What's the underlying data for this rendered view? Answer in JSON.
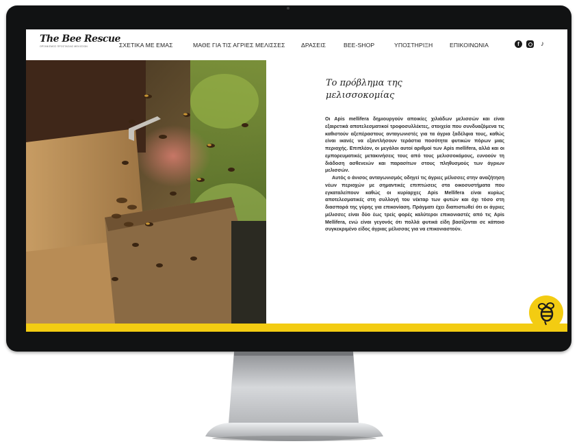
{
  "site": {
    "logo_title": "The Bee Rescue",
    "logo_subtitle": "ΟΡΓΑΝΙΣΜΟΣ ΠΡΟΣΤΑΣΙΑΣ ΜΕΛΙΣΣΩΝ"
  },
  "nav": {
    "items": [
      {
        "label": "ΣΧΕΤΙΚΑ ΜΕ ΕΜΑΣ"
      },
      {
        "label": "ΜΑΘΕ ΓΙΑ ΤΙΣ ΑΓΡΙΕΣ ΜΕΛΙΣΣΕΣ"
      },
      {
        "label": "ΔΡΑΣΕΙΣ"
      },
      {
        "label": "BEE-SHOP"
      },
      {
        "label": "ΥΠΟΣΤΗΡΙΞΗ"
      },
      {
        "label": "ΕΠΙΚΟΙΝΩΝΙΑ"
      }
    ],
    "social": [
      "facebook-icon",
      "instagram-icon",
      "tiktok-icon"
    ]
  },
  "article": {
    "heading_line1": "Το πρόβλημα της",
    "heading_line2": "μελισσοκομίας",
    "paragraph1": "Οι Apis mellifera δημιουργούν αποικίες χιλιάδων μελισσών και είναι εξαιρετικά αποτελεσματικοί τροφοσυλλέκτες, στοιχεία που συνδυαζόμενα τις καθιστούν αξεπέραστους ανταγωνιστές για τα άγρια ξαδέλφια τους, καθώς είναι ικανές να εξαντλήσουν τεράστια ποσότητα φυτικών πόρων μιας περιοχής. Επιπλέον, οι μεγάλοι αυτοί αριθμοί των Apis mellifera, αλλά και οι εμπορευματικές μετακινήσεις τους από τους μελισσοκόμους, ευνοούν τη διάδοση ασθενειών και παρασίτων στους πληθυσμούς των άγριων μελισσών.",
    "paragraph2": "Αυτός ο άνισος ανταγωνισμός οδηγεί τις άγριες μέλισσες στην αναζήτηση νέων περιοχών με σημαντικές επιπτώσεις στα οικοσυστήματα που εγκαταλείπουν καθώς οι κυρίαρχες Apis Mellifera είναι κυρίως αποτελεσματικές στη συλλογή του νέκταρ των φυτών και όχι τόσο στη διασπορά της γύρης για επικονίαση. Πράγματι έχει διαπιστωθεί ότι οι άγριες μέλισσες είναι δύο έως τρείς φορές καλύτεροι επικονιαστές από τις Apis Mellifera, ενώ είναι γεγονός ότι πολλά φυτικά είδη βασίζονται σε κάποιο συγκεκριμένο είδος άγριας μέλισσας για να επικονιαστούν."
  },
  "colors": {
    "accent_yellow": "#f3cc12",
    "bezel": "#111213",
    "text": "#2a2a2a"
  }
}
